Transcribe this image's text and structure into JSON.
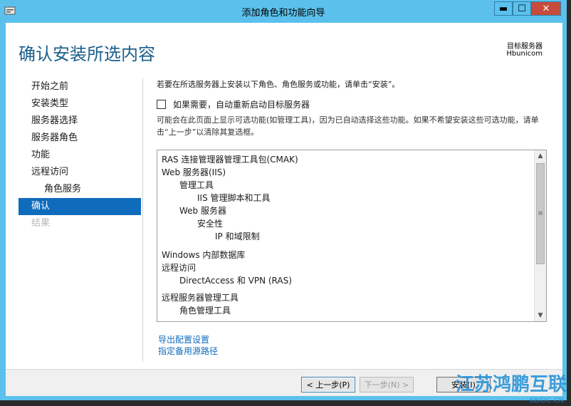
{
  "window": {
    "title": "添加角色和功能向导",
    "min": "▬",
    "max": "☐",
    "close": "✕"
  },
  "header": {
    "title": "确认安装所选内容",
    "target_label": "目标服务器",
    "target_value": "Hbunicom"
  },
  "nav": {
    "items": [
      {
        "label": "开始之前",
        "state": "normal"
      },
      {
        "label": "安装类型",
        "state": "normal"
      },
      {
        "label": "服务器选择",
        "state": "normal"
      },
      {
        "label": "服务器角色",
        "state": "normal"
      },
      {
        "label": "功能",
        "state": "normal"
      },
      {
        "label": "远程访问",
        "state": "normal"
      },
      {
        "label": "角色服务",
        "state": "sub"
      },
      {
        "label": "确认",
        "state": "active"
      },
      {
        "label": "结果",
        "state": "disabled"
      }
    ]
  },
  "content": {
    "intro": "若要在所选服务器上安装以下角色、角色服务或功能，请单击“安装”。",
    "checkbox_label": "如果需要，自动重新启动目标服务器",
    "note": "可能会在此页面上显示可选功能(如管理工具)，因为已自动选择这些功能。如果不希望安装这些可选功能，请单击“上一步”以清除其复选框。",
    "list": [
      {
        "text": "RAS 连接管理器管理工具包(CMAK)",
        "level": 0
      },
      {
        "text": "Web 服务器(IIS)",
        "level": 0
      },
      {
        "text": "管理工具",
        "level": 1
      },
      {
        "text": "IIS 管理脚本和工具",
        "level": 2
      },
      {
        "text": "Web 服务器",
        "level": 1
      },
      {
        "text": "安全性",
        "level": 2
      },
      {
        "text": "IP 和域限制",
        "level": 3
      },
      {
        "text": "Windows 内部数据库",
        "level": 0
      },
      {
        "text": "远程访问",
        "level": 0
      },
      {
        "text": "DirectAccess 和 VPN (RAS)",
        "level": 1
      },
      {
        "text": "远程服务器管理工具",
        "level": 0
      },
      {
        "text": "角色管理工具",
        "level": 1
      }
    ],
    "link_export": "导出配置设置",
    "link_source": "指定备用源路径"
  },
  "footer": {
    "prev": "< 上一步(P)",
    "next": "下一步(N) >",
    "install": "安装(I)"
  },
  "watermark": {
    "main": "江苏鸿鹏互联",
    "sub": "6BIDC.CN"
  }
}
